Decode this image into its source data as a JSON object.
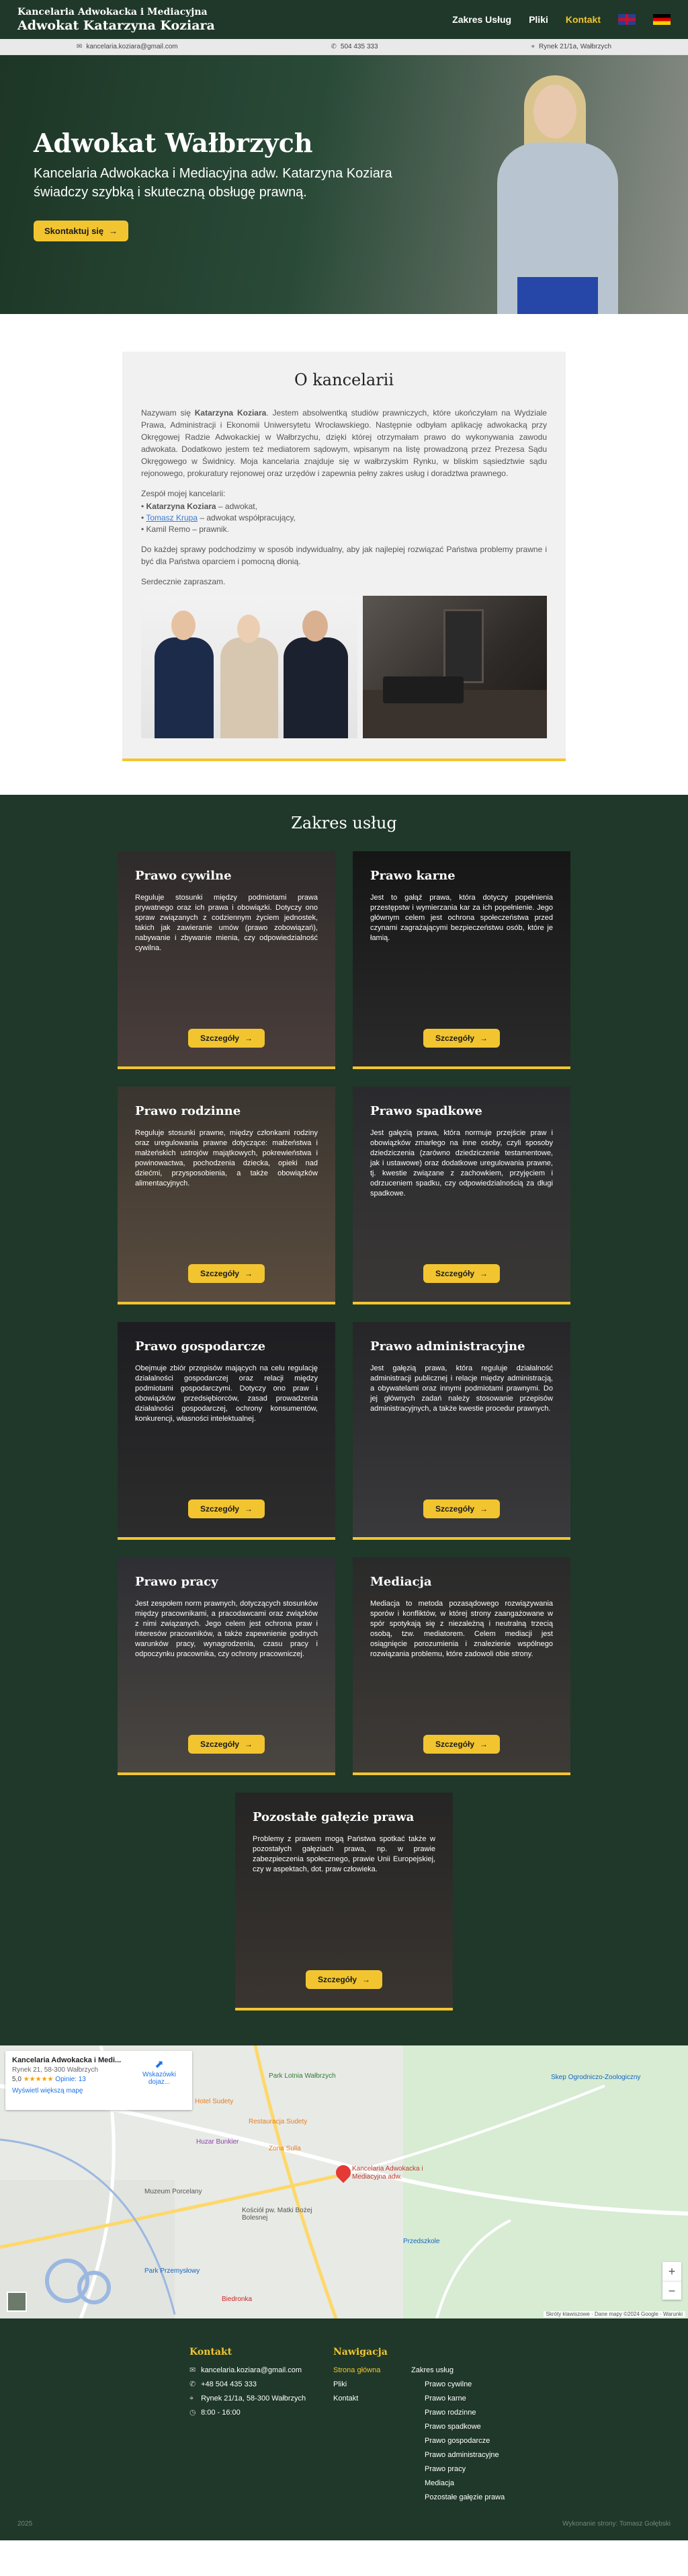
{
  "header": {
    "logo_line1": "Kancelaria Adwokacka i Mediacyjna",
    "logo_line2": "Adwokat Katarzyna Koziara",
    "nav": [
      "Zakres Usług",
      "Pliki",
      "Kontakt"
    ],
    "active": "Kontakt",
    "accent": "#f2c530",
    "bg": "#1f3829"
  },
  "contact_bar": {
    "email": "kancelaria.koziara@gmail.com",
    "phone": "504 435 333",
    "address": "Rynek 21/1a, Wałbrzych"
  },
  "hero": {
    "title": "Adwokat Wałbrzych",
    "subtitle": "Kancelaria Adwokacka i Mediacyjna adw. Katarzyna Koziara świadczy szybką i skuteczną obsługę prawną.",
    "cta": "Skontaktuj się"
  },
  "about": {
    "title": "O kancelarii",
    "p1_pre": "Nazywam się ",
    "p1_name": "Katarzyna Koziara",
    "p1_post": ". Jestem absolwentką studiów prawniczych, które ukończyłam na Wydziale Prawa, Administracji i Ekonomii Uniwersytetu Wrocławskiego. Następnie odbyłam aplikację adwokacką przy Okręgowej Radzie Adwokackiej w Wałbrzychu, dzięki której otrzymałam prawo do wykonywania zawodu adwokata. Dodatkowo jestem też mediatorem sądowym, wpisanym na listę prowadzoną przez Prezesa Sądu Okręgowego w Świdnicy. Moja kancelaria znajduje się w wałbrzyskim Rynku, w bliskim sąsiedztwie sądu rejonowego, prokuratury rejonowej oraz urzędów i zapewnia pełny zakres usług i doradztwa prawnego.",
    "team_label": "Zespół mojej kancelarii:",
    "team": [
      {
        "name": "Katarzyna Koziara",
        "role": " – adwokat,"
      },
      {
        "name": "Tomasz Krupa",
        "role": " – adwokat współpracujący,"
      },
      {
        "name": "Kamil Remo",
        "role": " – prawnik."
      }
    ],
    "p2": "Do każdej sprawy podchodzimy w sposób indywidualny, aby jak najlepiej rozwiązać Państwa problemy prawne i być dla Państwa oparciem i pomocną dłonią.",
    "p3": "Serdecznie zapraszam."
  },
  "services": {
    "title": "Zakres usług",
    "button": "Szczegóły",
    "items": [
      {
        "title": "Prawo cywilne",
        "text": "Reguluje stosunki między podmiotami prawa prywatnego oraz ich prawa i obowiązki. Dotyczy ono spraw związanych z codziennym życiem jednostek, takich jak zawieranie umów (prawo zobowiązań), nabywanie i zbywanie mienia, czy odpowiedzialność cywilna."
      },
      {
        "title": "Prawo karne",
        "text": "Jest to gałąź prawa, która dotyczy popełnienia przestępstw i wymierzania kar za ich popełnienie. Jego głównym celem jest ochrona społeczeństwa przed czynami zagrażającymi bezpieczeństwu osób, które je łamią."
      },
      {
        "title": "Prawo rodzinne",
        "text": "Reguluje stosunki prawne, między członkami rodziny oraz uregulowania prawne dotyczące: małżeństwa i małżeńskich ustrojów majątkowych, pokrewieństwa i powinowactwa, pochodzenia dziecka, opieki nad dziećmi, przysposobienia, a także obowiązków alimentacyjnych."
      },
      {
        "title": "Prawo spadkowe",
        "text": "Jest gałęzią prawa, która normuje przejście praw i obowiązków zmarłego na inne osoby, czyli sposoby dziedziczenia (zarówno dziedziczenie testamentowe, jak i ustawowe) oraz dodatkowe uregulowania prawne, tj. kwestie związane z zachowkiem, przyjęciem i odrzuceniem spadku, czy odpowiedzialnością za długi spadkowe."
      },
      {
        "title": "Prawo gospodarcze",
        "text": "Obejmuje zbiór przepisów mających na celu regulację działalności gospodarczej oraz relacji między podmiotami gospodarczymi. Dotyczy ono praw i obowiązków przedsiębiorców, zasad prowadzenia działalności gospodarczej, ochrony konsumentów, konkurencji, własności intelektualnej."
      },
      {
        "title": "Prawo administracyjne",
        "text": "Jest gałęzią prawa, która reguluje działalność administracji publicznej i relacje między administracją, a obywatelami oraz innymi podmiotami prawnymi. Do jej głównych zadań należy stosowanie przepisów administracyjnych, a także kwestie procedur prawnych."
      },
      {
        "title": "Prawo pracy",
        "text": "Jest zespołem norm prawnych, dotyczących stosunków między pracownikami, a pracodawcami oraz związków z nimi związanych. Jego celem jest ochrona praw i interesów pracowników, a także zapewnienie godnych warunków pracy, wynagrodzenia, czasu pracy i odpoczynku pracownika, czy ochrony pracowniczej."
      },
      {
        "title": "Mediacja",
        "text": "Mediacja to metoda pozasądowego rozwiązywania sporów i konfliktów, w której strony zaangażowane w spór spotykają się z niezależną i neutralną trzecią osobą, tzw. mediatorem. Celem mediacji jest osiągnięcie porozumienia i znalezienie wspólnego rozwiązania problemu, które zadowoli obie strony."
      },
      {
        "title": "Pozostałe gałęzie prawa",
        "text": "Problemy z prawem mogą Państwa spotkać także w pozostałych gałęziach prawa, np. w prawie zabezpieczenia społecznego, prawie Unii Europejskiej, czy w aspektach, dot. praw człowieka."
      }
    ]
  },
  "map": {
    "card_title": "Kancelaria Adwokacka i Medi...",
    "card_address": "Rynek 21, 58-300 Wałbrzych",
    "rating": "5,0",
    "stars": "★★★★★",
    "reviews": "Opinie: 13",
    "larger_map": "Wyświetl większą mapę",
    "directions": "Wskazówki dojaz...",
    "pin_label": "Kancelaria Adwokacka i Mediacyjna adw.",
    "pois": [
      "Park Lotnia Wałbrzych",
      "Hotel Sudety",
      "Restauracja Sudety",
      "Zona Sulla",
      "Huzar Bunkier",
      "Skep Ogrodniczo-Zoologiczny",
      "Muzeum Porcelany",
      "Park Przemysłowy",
      "Kościół pw. Matki Bożej Bolesnej",
      "Biedronka",
      "Przedszkole"
    ],
    "footer_text": "Skróty klawiszowe · Dane mapy ©2024 Google · Warunki"
  },
  "footer": {
    "contact_title": "Kontakt",
    "email": "kancelaria.koziara@gmail.com",
    "phone": "+48 504 435 333",
    "address": "Rynek 21/1a, 58-300 Wałbrzych",
    "hours": "8:00 - 16:00",
    "nav_title": "Nawigacja",
    "nav": [
      "Strona główna",
      "Pliki",
      "Kontakt"
    ],
    "services_title": "Zakres usług",
    "services": [
      "Prawo cywilne",
      "Prawo karne",
      "Prawo rodzinne",
      "Prawo spadkowe",
      "Prawo gospodarcze",
      "Prawo administracyjne",
      "Prawo pracy",
      "Mediacja",
      "Pozostałe gałęzie prawa"
    ],
    "copyright": "2025",
    "credit": "Wykonanie strony: Tomasz Gołębski"
  }
}
